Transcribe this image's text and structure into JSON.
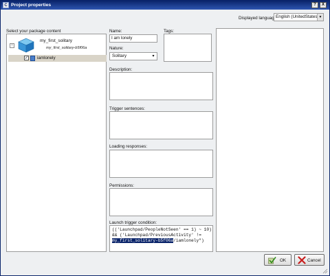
{
  "window": {
    "title": "Project properties",
    "app_icon_letter": "C"
  },
  "titlebar_buttons": {
    "help": "?",
    "close": "X"
  },
  "language": {
    "label": "Displayed language",
    "value": "English (UnitedStates)"
  },
  "tree": {
    "label": "Select your package content",
    "root": {
      "name": "my_first_solitary",
      "id": "my_first_solitary-b5f06a"
    },
    "child": {
      "name": "iamlonely",
      "checked": "✓"
    }
  },
  "form": {
    "name_label": "Name:",
    "name_value": "I am lonely",
    "tags_label": "Tags:",
    "nature_label": "Nature:",
    "nature_value": "Solitary",
    "description_label": "Description:",
    "trigger_label": "Trigger sentences:",
    "loading_label": "Loading responses:",
    "permissions_label": "Permissions:",
    "launch_label": "Launch trigger condition:",
    "launch_code": {
      "line1": "(('Launchpad/PeopleNotSeen' == 1) ~ 10)",
      "line2": "&& ('Launchpad/PreviousActivity' !=",
      "line3_highlight": "my_first_solitary-b5f06a",
      "line3_rest": "/iamlonely\")"
    }
  },
  "buttons": {
    "ok": "OK",
    "cancel": "Cancel"
  }
}
